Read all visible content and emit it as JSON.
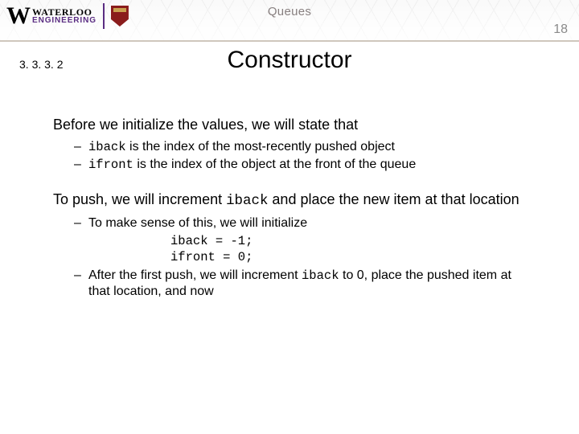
{
  "header": {
    "logo_top": "WATERLOO",
    "logo_bottom": "ENGINEERING",
    "topic": "Queues",
    "page_number": "18"
  },
  "section_number": "3. 3. 3. 2",
  "title": "Constructor",
  "body": {
    "p1": "Before we initialize the values, we will state that",
    "b1_pre": "iback",
    "b1_post": " is the index of the most-recently pushed object",
    "b2_pre": "ifront",
    "b2_post": " is the index of the object at the front of the queue",
    "p2_a": "To push, we will increment ",
    "p2_code": "iback",
    "p2_b": " and place the new item at that location",
    "b3": "To make sense of this, we will initialize",
    "code1": "iback = -1;",
    "code2": "ifront = 0;",
    "b4_a": "After the first push, we will increment ",
    "b4_code": "iback",
    "b4_b": " to 0, place the pushed item at that location, and now"
  }
}
